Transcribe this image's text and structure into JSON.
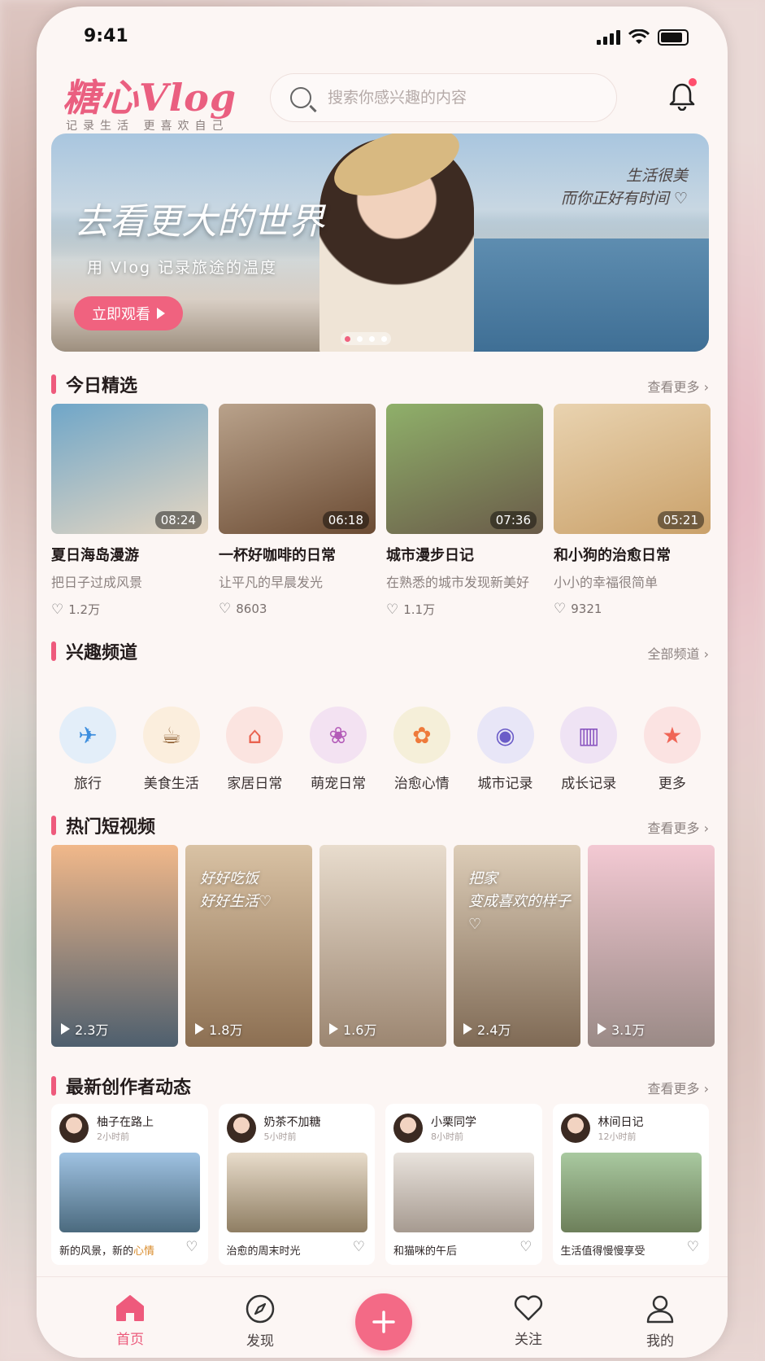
{
  "status": {
    "time": "9:41"
  },
  "header": {
    "logo": "糖心Vlog",
    "tagline": "记录生活  更喜欢自己",
    "search_placeholder": "搜索你感兴趣的内容"
  },
  "banner": {
    "title": "去看更大的世界",
    "subtitle": "用 Vlog 记录旅途的温度",
    "quote_line1": "生活很美",
    "quote_line2": "而你正好有时间 ♡",
    "button": "立即观看"
  },
  "today": {
    "title": "今日精选",
    "more": "查看更多 ›",
    "cards": [
      {
        "title": "夏日海岛漫游",
        "desc": "把日子过成风景",
        "duration": "08:24",
        "likes": "1.2万",
        "colors": [
          "#6fa6c8",
          "#e7d7c2"
        ]
      },
      {
        "title": "一杯好咖啡的日常",
        "desc": "让平凡的早晨发光",
        "duration": "06:18",
        "likes": "8603",
        "colors": [
          "#b9a28b",
          "#6b4b33"
        ]
      },
      {
        "title": "城市漫步日记",
        "desc": "在熟悉的城市发现新美好",
        "duration": "07:36",
        "likes": "1.1万",
        "colors": [
          "#8fb06a",
          "#6a5b49"
        ]
      },
      {
        "title": "和小狗的治愈日常",
        "desc": "小小的幸福很简单",
        "duration": "05:21",
        "likes": "9321",
        "colors": [
          "#e9d3b0",
          "#caa16a"
        ]
      }
    ]
  },
  "channels": {
    "title": "兴趣频道",
    "more": "全部频道 ›",
    "items": [
      {
        "label": "旅行",
        "icon": "✈",
        "bg": "#e3eef9",
        "fg": "#3d8ede"
      },
      {
        "label": "美食生活",
        "icon": "☕",
        "bg": "#fbeedd",
        "fg": "#8a5a2c"
      },
      {
        "label": "家居日常",
        "icon": "⌂",
        "bg": "#fbe4e0",
        "fg": "#e9624f"
      },
      {
        "label": "萌宠日常",
        "icon": "❀",
        "bg": "#f3e2f2",
        "fg": "#b35bb8"
      },
      {
        "label": "治愈心情",
        "icon": "✿",
        "bg": "#f5efd9",
        "fg": "#ee7a3b"
      },
      {
        "label": "城市记录",
        "icon": "◉",
        "bg": "#e8e6f7",
        "fg": "#6b5cc8"
      },
      {
        "label": "成长记录",
        "icon": "▥",
        "bg": "#efe3f4",
        "fg": "#8a56c0"
      },
      {
        "label": "更多",
        "icon": "★",
        "bg": "#fbe3e2",
        "fg": "#f06556"
      }
    ]
  },
  "shorts": {
    "title": "热门短视频",
    "more": "查看更多 ›",
    "items": [
      {
        "views": "2.3万",
        "caption": "",
        "colors": [
          "#f1b88a",
          "#4e5f6e"
        ]
      },
      {
        "views": "1.8万",
        "caption": "好好吃饭\n好好生活♡",
        "colors": [
          "#d9c2a4",
          "#8c6f52"
        ]
      },
      {
        "views": "1.6万",
        "caption": "",
        "colors": [
          "#e8dccd",
          "#9c8671"
        ]
      },
      {
        "views": "2.4万",
        "caption": "把家\n变成喜欢的样子♡",
        "colors": [
          "#ddcdb8",
          "#7f6a55"
        ]
      },
      {
        "views": "3.1万",
        "caption": "",
        "colors": [
          "#f3c9d3",
          "#9a8a86"
        ]
      }
    ]
  },
  "posts": {
    "title": "最新创作者动态",
    "more": "查看更多 ›",
    "items": [
      {
        "name": "柚子在路上",
        "ago": "2小时前",
        "text": "新的风景，新的",
        "highlight": "心情",
        "colors": [
          "#9fc2e2",
          "#4b6a7e"
        ]
      },
      {
        "name": "奶茶不加糖",
        "ago": "5小时前",
        "text": "治愈的周末时光",
        "highlight": "",
        "colors": [
          "#e8dccb",
          "#8f7e63"
        ]
      },
      {
        "name": "小栗同学",
        "ago": "8小时前",
        "text": "和猫咪的午后",
        "highlight": "",
        "colors": [
          "#e9e3dd",
          "#a69a90"
        ]
      },
      {
        "name": "林间日记",
        "ago": "12小时前",
        "text": "生活值得慢慢享受",
        "highlight": "",
        "colors": [
          "#a9c9a0",
          "#6d7f5a"
        ]
      }
    ]
  },
  "tabbar": {
    "items": [
      {
        "label": "首页",
        "icon": "home-icon",
        "active": true
      },
      {
        "label": "发现",
        "icon": "compass-icon",
        "active": false
      },
      {
        "label": "",
        "icon": "plus-icon",
        "active": false
      },
      {
        "label": "关注",
        "icon": "heart-icon",
        "active": false
      },
      {
        "label": "我的",
        "icon": "user-icon",
        "active": false
      }
    ]
  },
  "colors": {
    "accent": "#ee5a7c",
    "background": "#fcf6f4"
  }
}
